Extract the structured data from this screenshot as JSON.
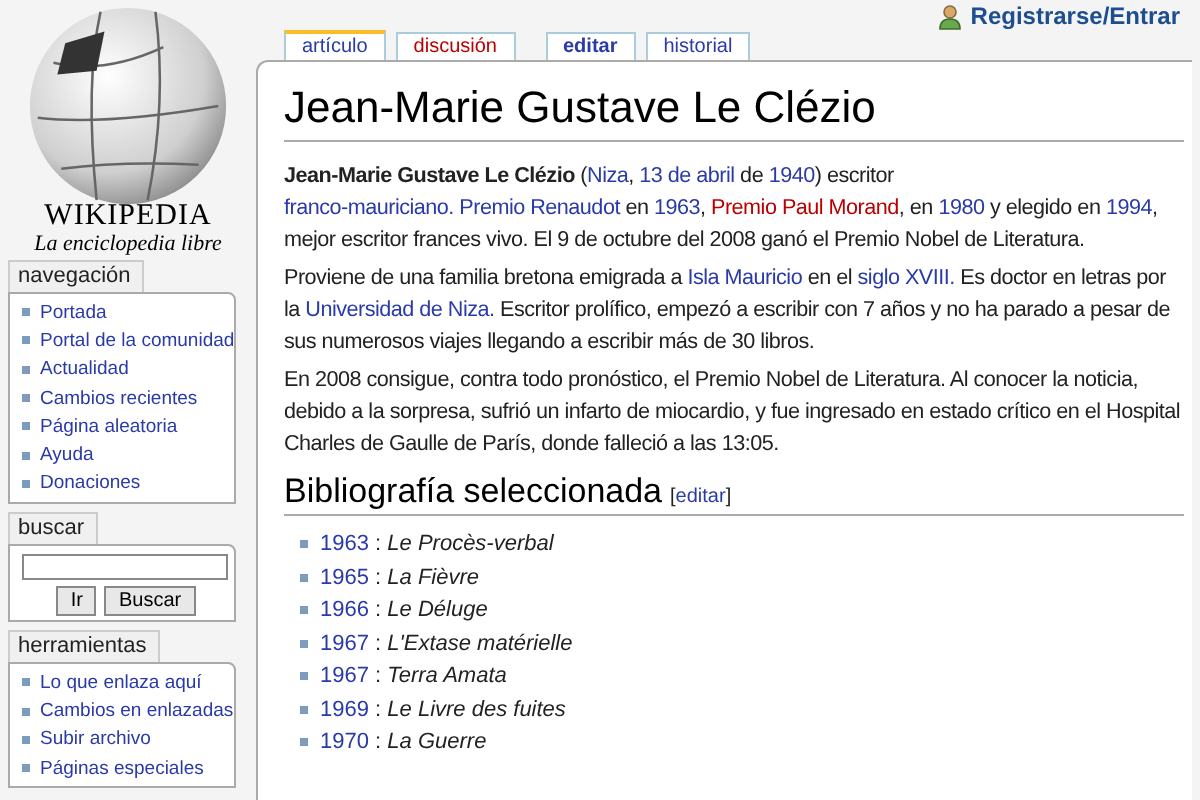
{
  "logo": {
    "wordmark": "WIKIPEDIA",
    "tagline": "La enciclopedia libre"
  },
  "user_link": "Registrarse/Entrar",
  "tabs": [
    {
      "label": "artículo",
      "selected": true,
      "kind": "page"
    },
    {
      "label": "discusión",
      "selected": false,
      "kind": "missing"
    },
    {
      "label": "editar",
      "selected": false,
      "kind": "action"
    },
    {
      "label": "historial",
      "selected": false,
      "kind": "page"
    }
  ],
  "sidebar": [
    {
      "title": "navegación",
      "kind": "links",
      "items": [
        "Portada",
        "Portal de la comunidad",
        "Actualidad",
        "Cambios recientes",
        "Página aleatoria",
        "Ayuda",
        "Donaciones"
      ]
    },
    {
      "title": "buscar",
      "kind": "search",
      "buttons": [
        "Ir",
        "Buscar"
      ]
    },
    {
      "title": "herramientas",
      "kind": "links",
      "items": [
        "Lo que enlaza aquí",
        "Cambios en enlazadas",
        "Subir archivo",
        "Páginas especiales"
      ]
    }
  ],
  "article": {
    "title": "Jean-Marie Gustave Le Clézio",
    "paragraphs": [
      [
        {
          "kind": "bold",
          "text": "Jean-Marie Gustave Le Clézio"
        },
        {
          "kind": "text",
          "text": " ("
        },
        {
          "kind": "link",
          "text": "Niza"
        },
        {
          "kind": "text",
          "text": ", "
        },
        {
          "kind": "link",
          "text": "13 de abril"
        },
        {
          "kind": "text",
          "text": " de "
        },
        {
          "kind": "link",
          "text": "1940"
        },
        {
          "kind": "text",
          "text": ") escritor "
        },
        {
          "kind": "link",
          "text": "franco-mauriciano. "
        },
        {
          "kind": "link",
          "text": "Premio Renaudot"
        },
        {
          "kind": "text",
          "text": " en "
        },
        {
          "kind": "link",
          "text": "1963"
        },
        {
          "kind": "text",
          "text": ", "
        },
        {
          "kind": "missing",
          "text": "Premio Paul Morand"
        },
        {
          "kind": "text",
          "text": ", en "
        },
        {
          "kind": "link",
          "text": "1980"
        },
        {
          "kind": "text",
          "text": " y elegido en "
        },
        {
          "kind": "link",
          "text": "1994"
        },
        {
          "kind": "text",
          "text": ", mejor escritor frances vivo. El 9 de octubre del 2008 ganó el Premio Nobel de Literatura."
        }
      ],
      [
        {
          "kind": "text",
          "text": "Proviene de una familia bretona emigrada a "
        },
        {
          "kind": "link",
          "text": "Isla Mauricio"
        },
        {
          "kind": "text",
          "text": " en el "
        },
        {
          "kind": "link",
          "text": "siglo XVIII."
        },
        {
          "kind": "text",
          "text": " Es doctor en letras por la "
        },
        {
          "kind": "link",
          "text": "Universidad de Niza."
        },
        {
          "kind": "text",
          "text": " Escritor prolífico, empezó a escribir con 7 años y no ha parado a pesar de sus numerosos viajes llegando a escribir más de 30 libros."
        }
      ],
      [
        {
          "kind": "text",
          "text": "En 2008 consigue, contra todo pronóstico, el Premio Nobel de Literatura. Al conocer la noticia, debido a la sorpresa, sufrió un infarto de miocardio, y fue ingresado en estado crítico en el Hospital Charles de Gaulle de París, donde falleció a las 13:05."
        }
      ]
    ],
    "section": {
      "title": "Bibliografía seleccionada",
      "edit_link": "editar",
      "bracket_open": "[",
      "bracket_close": "]"
    },
    "bibliography": [
      {
        "year": "1963",
        "separator": " : ",
        "title": "Le Procès-verbal"
      },
      {
        "year": "1965",
        "separator": " : ",
        "title": "La Fièvre"
      },
      {
        "year": "1966",
        "separator": " : ",
        "title": "Le Déluge"
      },
      {
        "year": "1967",
        "separator": " : ",
        "title": "L'Extase matérielle"
      },
      {
        "year": "1967",
        "separator": " : ",
        "title": "Terra Amata"
      },
      {
        "year": "1969",
        "separator": " : ",
        "title": "Le Livre des fuites"
      },
      {
        "year": "1970",
        "separator": " : ",
        "title": "La Guerre"
      }
    ]
  }
}
